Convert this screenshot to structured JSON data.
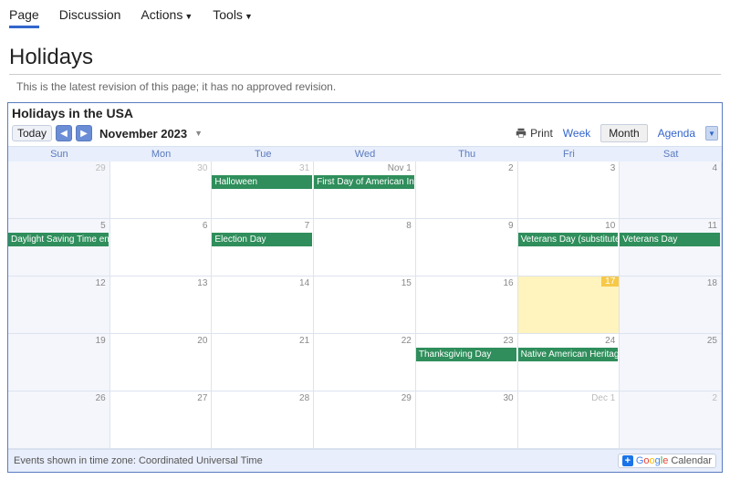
{
  "nav": {
    "page": "Page",
    "discussion": "Discussion",
    "actions": "Actions",
    "tools": "Tools"
  },
  "page_title": "Holidays",
  "revision_note": "This is the latest revision of this page; it has no approved revision.",
  "calendar": {
    "title": "Holidays in the USA",
    "today_btn": "Today",
    "month_label": "November 2023",
    "print": "Print",
    "views": {
      "week": "Week",
      "month": "Month",
      "agenda": "Agenda"
    },
    "dow": [
      "Sun",
      "Mon",
      "Tue",
      "Wed",
      "Thu",
      "Fri",
      "Sat"
    ],
    "cells": [
      {
        "num": "29",
        "other": true
      },
      {
        "num": "30",
        "other": true
      },
      {
        "num": "31",
        "other": true,
        "event": "Halloween"
      },
      {
        "num": "Nov 1",
        "event": "First Day of American Indian Heritage"
      },
      {
        "num": "2"
      },
      {
        "num": "3"
      },
      {
        "num": "4"
      },
      {
        "num": "5",
        "event": "Daylight Saving Time ends"
      },
      {
        "num": "6"
      },
      {
        "num": "7",
        "event": "Election Day"
      },
      {
        "num": "8"
      },
      {
        "num": "9"
      },
      {
        "num": "10",
        "event": "Veterans Day (substitute)"
      },
      {
        "num": "11",
        "event": "Veterans Day"
      },
      {
        "num": "12"
      },
      {
        "num": "13"
      },
      {
        "num": "14"
      },
      {
        "num": "15"
      },
      {
        "num": "16"
      },
      {
        "num": "17",
        "today": true
      },
      {
        "num": "18"
      },
      {
        "num": "19"
      },
      {
        "num": "20"
      },
      {
        "num": "21"
      },
      {
        "num": "22"
      },
      {
        "num": "23",
        "event": "Thanksgiving Day"
      },
      {
        "num": "24",
        "event": "Native American Heritage"
      },
      {
        "num": "25"
      },
      {
        "num": "26"
      },
      {
        "num": "27"
      },
      {
        "num": "28"
      },
      {
        "num": "29"
      },
      {
        "num": "30"
      },
      {
        "num": "Dec 1",
        "other": true
      },
      {
        "num": "2",
        "other": true
      }
    ],
    "footer_tz": "Events shown in time zone: Coordinated Universal Time",
    "gcal_label": "Calendar"
  }
}
